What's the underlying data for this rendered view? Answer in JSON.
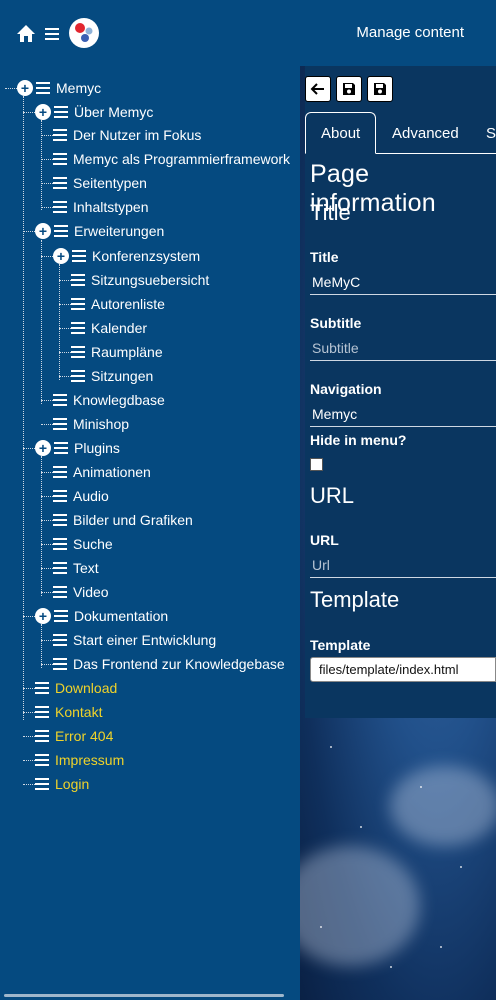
{
  "header": {
    "manage_label": "Manage content",
    "icons": {
      "home": "home-icon",
      "menu": "hamburger-menu-icon",
      "logo": "memyc-logo-icon"
    }
  },
  "tree": {
    "root": "Memyc",
    "items": [
      "Über Memyc",
      "Der Nutzer im Fokus",
      "Memyc als Programmierframework",
      "Seitentypen",
      "Inhaltstypen",
      "Erweiterungen",
      "Konferenzsystem",
      "Sitzungsuebersicht",
      "Autorenliste",
      "Kalender",
      "Raumpläne",
      "Sitzungen",
      "Knowlegdbase",
      "Minishop",
      "Plugins",
      "Animationen",
      "Audio",
      "Bilder und Grafiken",
      "Suche",
      "Text",
      "Video",
      "Dokumentation",
      "Start einer Entwicklung",
      "Das Frontend zur Knowledgebase",
      "Download",
      "Kontakt",
      "Error 404",
      "Impressum",
      "Login"
    ]
  },
  "toolbar": {
    "back_icon": "arrow-left-icon",
    "save_icon": "save-icon",
    "save_all_icon": "save-icon"
  },
  "tabs": {
    "about": "About",
    "advanced": "Advanced",
    "third": "Se"
  },
  "form": {
    "heading": "Page information",
    "title_section": "Title",
    "title_label": "Title",
    "title_value": "MeMyC",
    "subtitle_label": "Subtitle",
    "subtitle_placeholder": "Subtitle",
    "navigation_label": "Navigation",
    "navigation_value": "Memyc",
    "hide_label": "Hide in menu?",
    "url_section": "URL",
    "url_label": "URL",
    "url_placeholder": "Url",
    "template_section": "Template",
    "template_label": "Template",
    "template_value": "files/template/index.html"
  },
  "colors": {
    "sidebar_bg": "#054a80",
    "highlight_text": "#f0d32a"
  }
}
